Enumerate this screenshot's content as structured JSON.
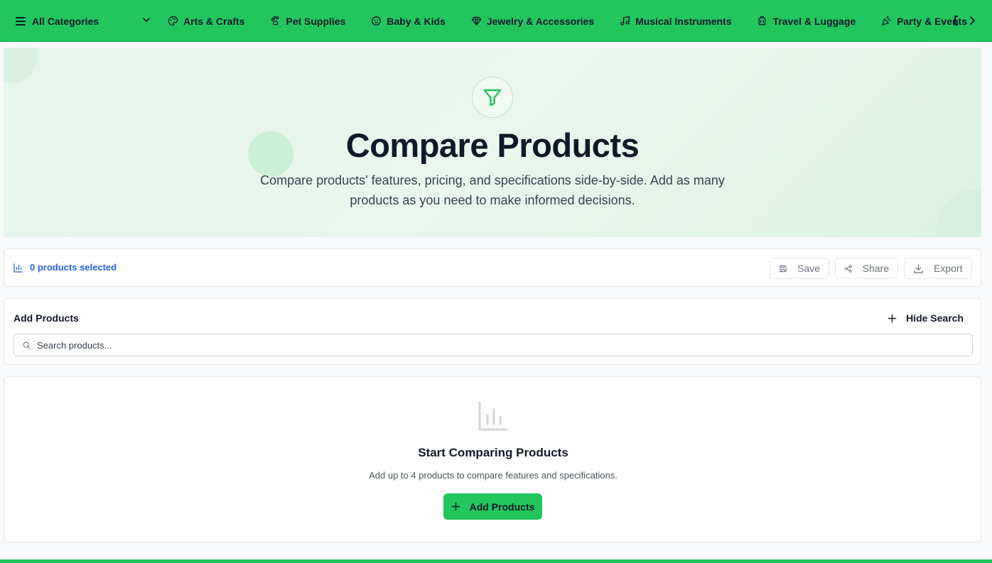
{
  "nav": {
    "all_categories": "All Categories",
    "items": [
      {
        "label": "Arts & Crafts",
        "icon": "palette-icon"
      },
      {
        "label": "Pet Supplies",
        "icon": "paw-icon"
      },
      {
        "label": "Baby & Kids",
        "icon": "baby-icon"
      },
      {
        "label": "Jewelry & Accessories",
        "icon": "gem-icon"
      },
      {
        "label": "Musical Instruments",
        "icon": "music-icon"
      },
      {
        "label": "Travel & Luggage",
        "icon": "luggage-icon"
      },
      {
        "label": "Party & Events",
        "icon": "party-icon"
      }
    ]
  },
  "hero": {
    "title": "Compare Products",
    "subtitle": "Compare products' features, pricing, and specifications side-by-side. Add as many products as you need to make informed decisions."
  },
  "selection": {
    "count_label": "0 products selected",
    "save": "Save",
    "share": "Share",
    "export": "Export"
  },
  "add_panel": {
    "title": "Add Products",
    "toggle_label": "Hide Search",
    "search_placeholder": "Search products..."
  },
  "empty_state": {
    "title": "Start Comparing Products",
    "description": "Add up to 4 products to compare features and specifications.",
    "button": "Add Products"
  },
  "colors": {
    "brand": "#22c55e",
    "link": "#2563eb"
  }
}
